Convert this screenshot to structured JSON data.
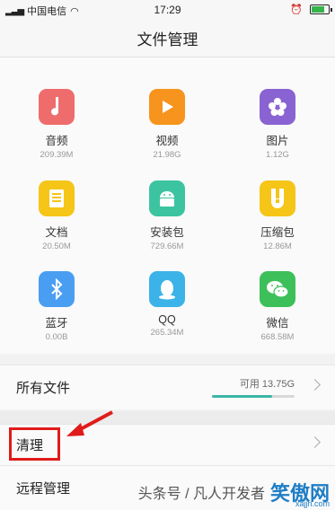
{
  "status_bar": {
    "carrier": "中国电信",
    "signal_text": "㗊",
    "time": "17:29"
  },
  "header": {
    "title": "文件管理"
  },
  "categories": [
    {
      "label": "音频",
      "size": "209.39M",
      "color": "#ef6c6c",
      "icon": "music-note-icon"
    },
    {
      "label": "视频",
      "size": "21.98G",
      "color": "#f7941d",
      "icon": "play-icon"
    },
    {
      "label": "图片",
      "size": "1.12G",
      "color": "#8a63d2",
      "icon": "flower-icon"
    },
    {
      "label": "文档",
      "size": "20.50M",
      "color": "#f5c518",
      "icon": "document-icon"
    },
    {
      "label": "安装包",
      "size": "729.66M",
      "color": "#3cc4a0",
      "icon": "android-icon"
    },
    {
      "label": "压缩包",
      "size": "12.86M",
      "color": "#f5c518",
      "icon": "zip-icon"
    },
    {
      "label": "蓝牙",
      "size": "0.00B",
      "color": "#4a9ef2",
      "icon": "bluetooth-icon"
    },
    {
      "label": "QQ",
      "size": "265.34M",
      "color": "#3bb3e8",
      "icon": "qq-icon"
    },
    {
      "label": "微信",
      "size": "668.58M",
      "color": "#3dbf5a",
      "icon": "wechat-icon"
    }
  ],
  "all_files": {
    "label": "所有文件",
    "available": "可用 13.75G",
    "used_fraction": 0.73
  },
  "clean": {
    "label": "清理"
  },
  "remote": {
    "label": "远程管理"
  },
  "watermark": {
    "text": "头条号 / 凡人开发者",
    "logo": "笑傲网",
    "url": "xajjn.com"
  }
}
